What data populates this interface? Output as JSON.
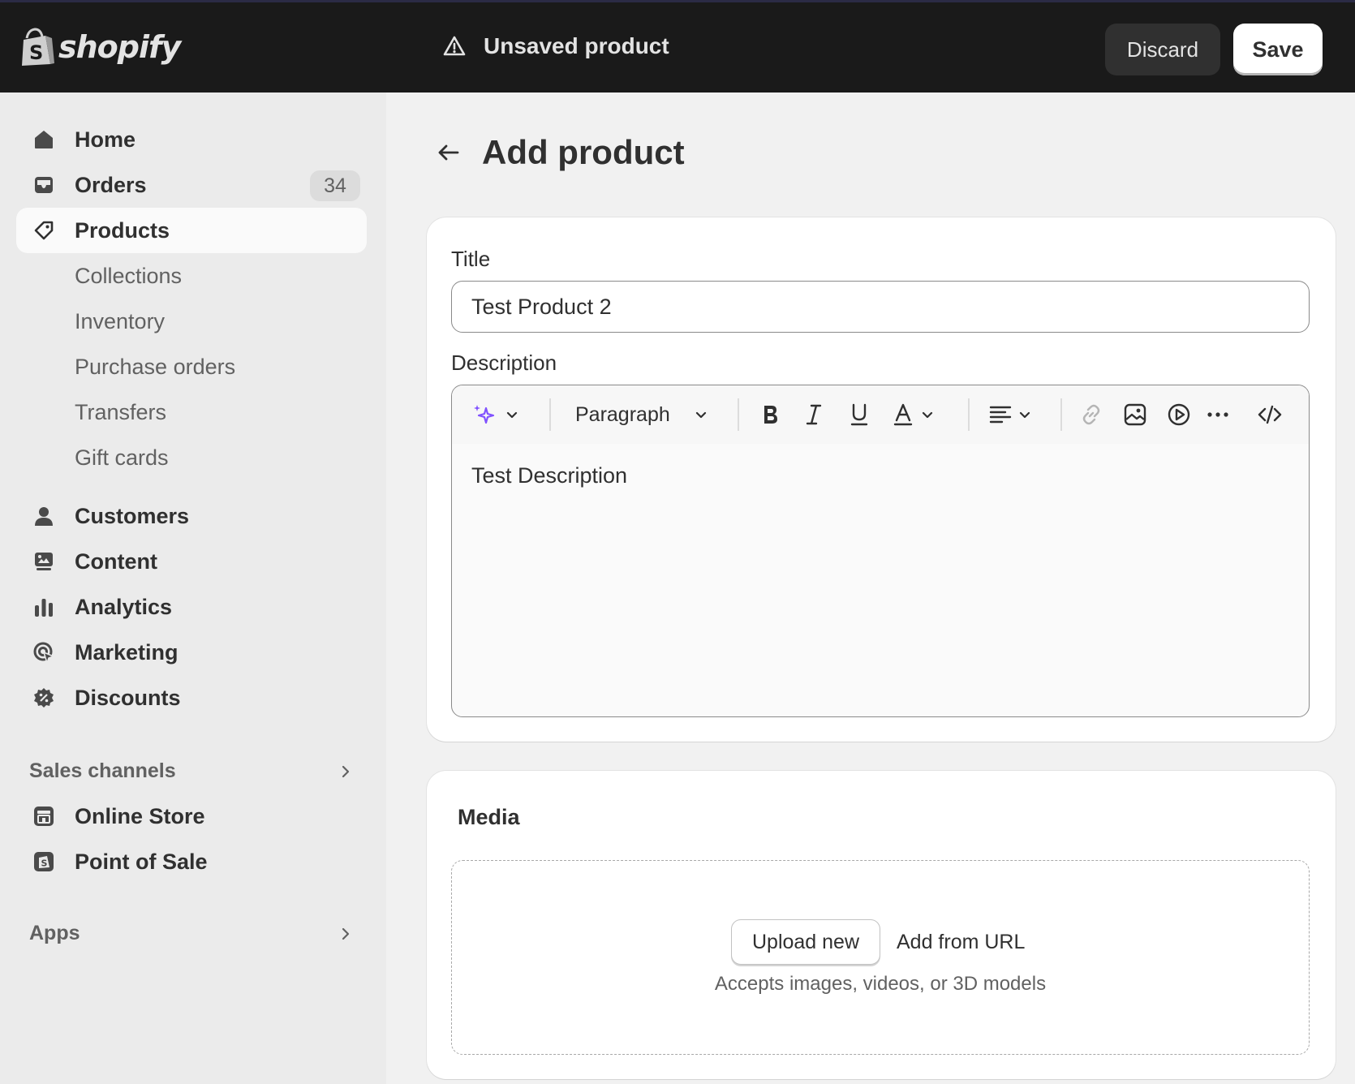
{
  "topbar": {
    "brand": "shopify",
    "status": "Unsaved product",
    "discard_label": "Discard",
    "save_label": "Save"
  },
  "sidebar": {
    "items": [
      {
        "label": "Home",
        "icon": "home-icon"
      },
      {
        "label": "Orders",
        "icon": "inbox-icon",
        "badge": "34"
      },
      {
        "label": "Products",
        "icon": "tag-icon",
        "active": true
      },
      {
        "label": "Collections"
      },
      {
        "label": "Inventory"
      },
      {
        "label": "Purchase orders"
      },
      {
        "label": "Transfers"
      },
      {
        "label": "Gift cards"
      },
      {
        "label": "Customers",
        "icon": "person-icon"
      },
      {
        "label": "Content",
        "icon": "content-icon"
      },
      {
        "label": "Analytics",
        "icon": "bar-chart-icon"
      },
      {
        "label": "Marketing",
        "icon": "target-icon"
      },
      {
        "label": "Discounts",
        "icon": "discount-icon"
      }
    ],
    "sales_channels": {
      "header": "Sales channels",
      "items": [
        {
          "label": "Online Store",
          "icon": "store-icon"
        },
        {
          "label": "Point of Sale",
          "icon": "pos-icon"
        }
      ]
    },
    "apps_header": "Apps"
  },
  "main": {
    "page_title": "Add product",
    "title_field": {
      "label": "Title",
      "value": "Test Product 2"
    },
    "description": {
      "label": "Description",
      "toolbar": {
        "format_label": "Paragraph",
        "icons": [
          "magic-icon",
          "bold-icon",
          "italic-icon",
          "underline-icon",
          "text-color-icon",
          "align-icon",
          "link-icon",
          "image-icon",
          "video-icon",
          "more-icon",
          "code-icon"
        ]
      },
      "value": "Test Description"
    },
    "media": {
      "title": "Media",
      "upload_label": "Upload new",
      "url_label": "Add from URL",
      "hint": "Accepts images, videos, or 3D models"
    }
  },
  "colors": {
    "topbar_bg": "#1a1a1a",
    "sidebar_bg": "#ebebeb",
    "page_bg": "#f1f1f1",
    "magic_accent": "#8051ff"
  }
}
